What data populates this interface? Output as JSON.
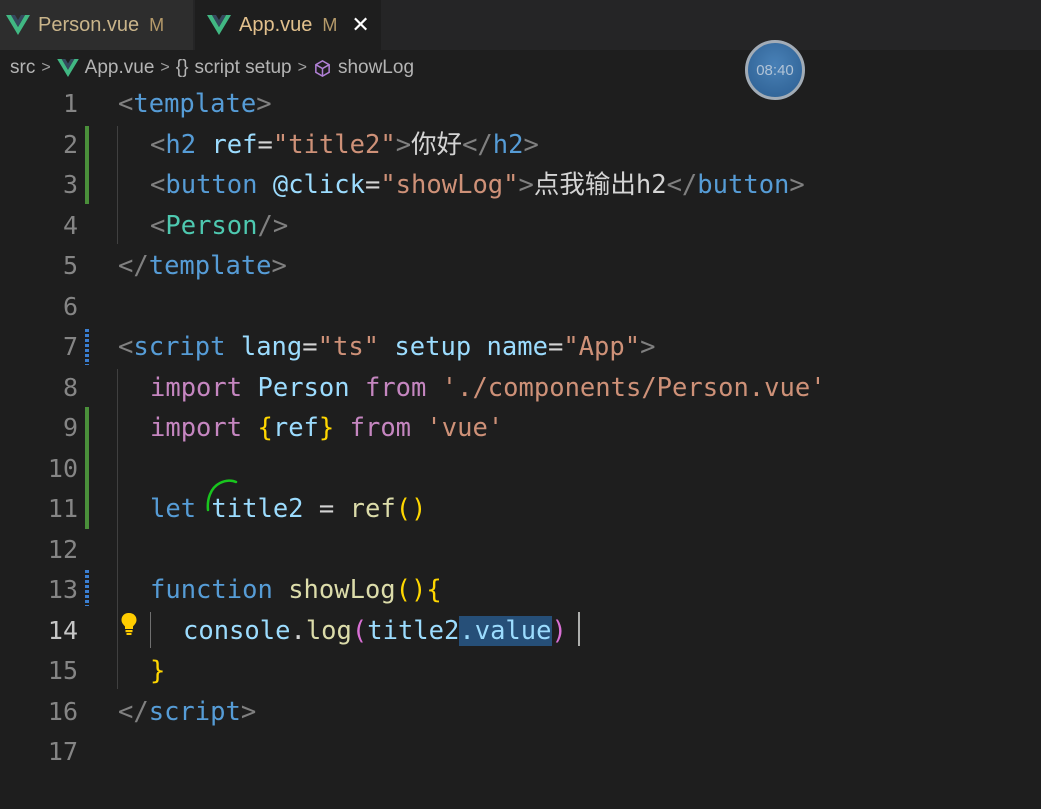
{
  "tabs": [
    {
      "name": "Person.vue",
      "status": "M",
      "active": false
    },
    {
      "name": "App.vue",
      "status": "M",
      "active": true
    }
  ],
  "breadcrumb": {
    "folder": "src",
    "file": "App.vue",
    "block": "script setup",
    "symbol": "showLog"
  },
  "timer": "08:40",
  "editor": {
    "active_line": 14,
    "line_numbers": [
      "1",
      "2",
      "3",
      "4",
      "5",
      "6",
      "7",
      "8",
      "9",
      "10",
      "11",
      "12",
      "13",
      "14",
      "15",
      "16",
      "17"
    ],
    "lines": [
      {
        "tokens": [
          "<",
          "template",
          ">"
        ]
      },
      {
        "tokens": [
          "<",
          "h2",
          " ",
          "ref",
          "=",
          "\"title2\"",
          ">",
          "你好",
          "</",
          "h2",
          ">"
        ]
      },
      {
        "tokens": [
          "<",
          "button",
          " ",
          "@click",
          "=",
          "\"showLog\"",
          ">",
          "点我输出h2",
          "</",
          "button",
          ">"
        ]
      },
      {
        "tokens": [
          "<",
          "Person",
          "/>"
        ]
      },
      {
        "tokens": [
          "</",
          "template",
          ">"
        ]
      },
      {
        "tokens": []
      },
      {
        "tokens": [
          "<",
          "script",
          " ",
          "lang",
          "=",
          "\"ts\"",
          " ",
          "setup",
          " ",
          "name",
          "=",
          "\"App\"",
          ">"
        ]
      },
      {
        "tokens": [
          "import",
          " ",
          "Person",
          " ",
          "from",
          " ",
          "'./components/Person.vue'"
        ]
      },
      {
        "tokens": [
          "import",
          " ",
          "{",
          "ref",
          "}",
          " ",
          "from",
          " ",
          "'vue'"
        ]
      },
      {
        "tokens": []
      },
      {
        "tokens": [
          "let",
          " ",
          "title2",
          " ",
          "=",
          " ",
          "ref",
          "(",
          ")"
        ]
      },
      {
        "tokens": []
      },
      {
        "tokens": [
          "function",
          " ",
          "showLog",
          "(",
          ")",
          "{"
        ]
      },
      {
        "tokens": [
          "console",
          ".",
          "log",
          "(",
          "title2",
          ".value",
          ")"
        ]
      },
      {
        "tokens": [
          "}"
        ]
      },
      {
        "tokens": [
          "</",
          "script",
          ">"
        ]
      },
      {
        "tokens": []
      }
    ]
  },
  "colors": {
    "background": "#1e1e1e",
    "tag": "#569cd6",
    "component": "#4ec9b0",
    "attribute": "#9cdcfe",
    "string": "#ce9178",
    "keyword": "#c586c0",
    "function": "#dcdcaa",
    "bracket_gold": "#ffd700",
    "bracket_orchid": "#da70d6",
    "selection": "#264f78",
    "modified_gutter": "#4a8f3a"
  },
  "icons": [
    "vue-icon",
    "close-icon",
    "chevron-right-icon",
    "braces-icon",
    "symbol-method-icon",
    "lightbulb-icon"
  ]
}
